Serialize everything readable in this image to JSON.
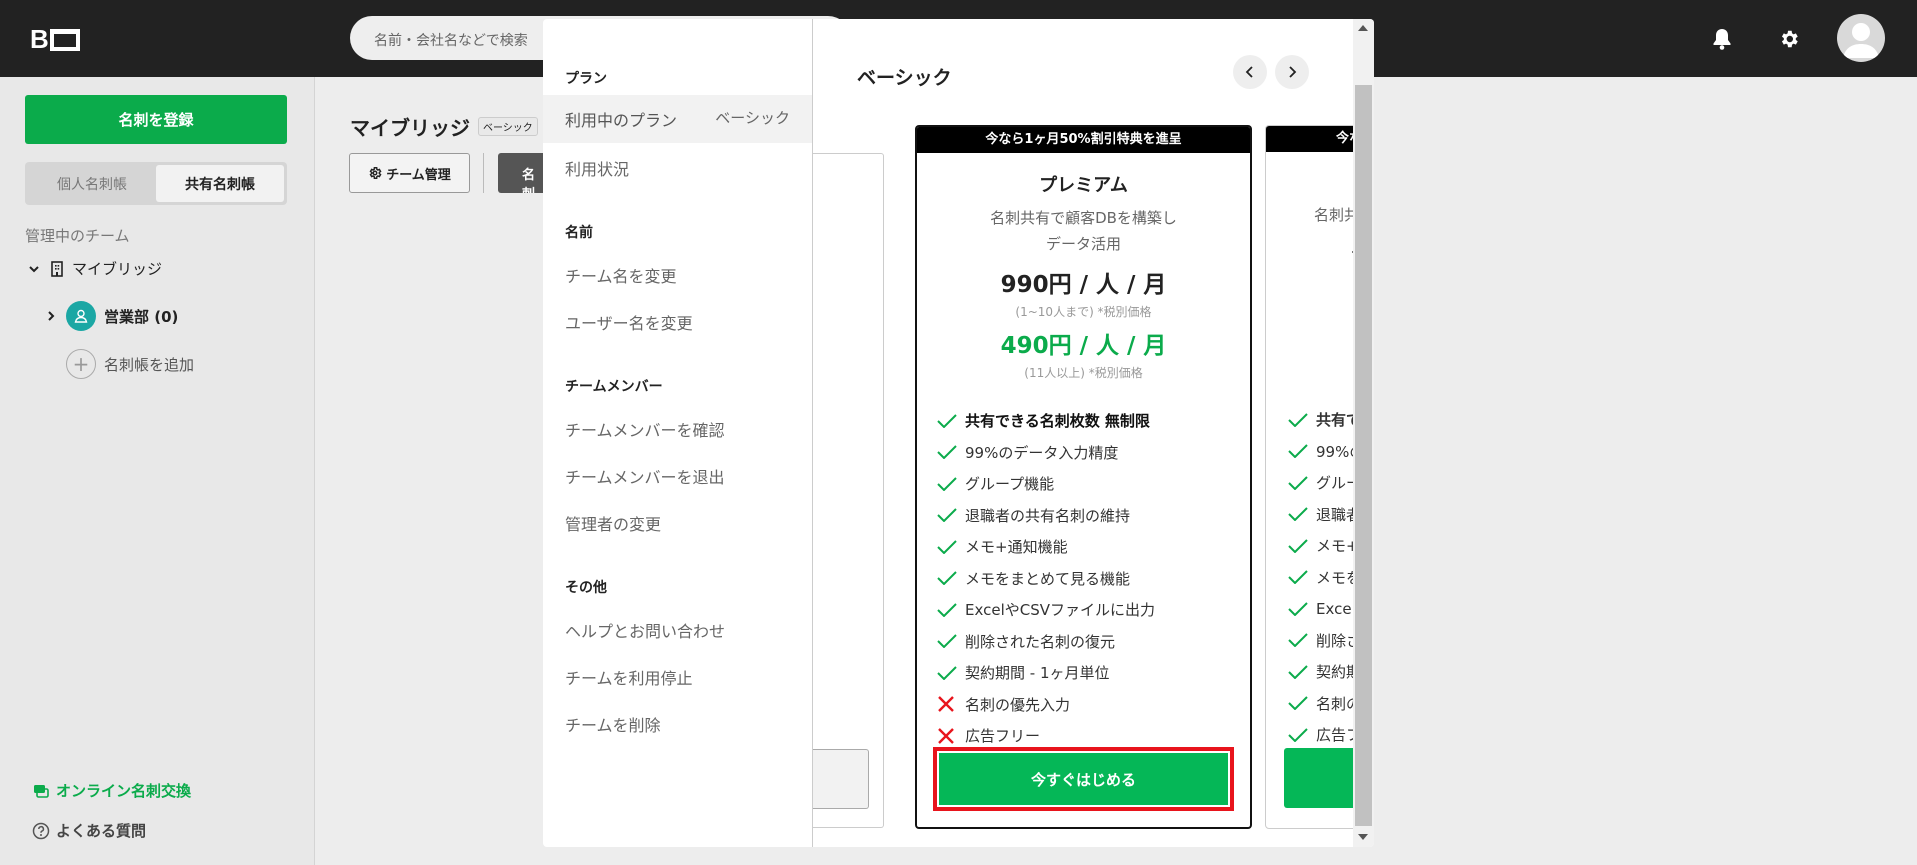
{
  "topbar": {
    "logo_text": "B",
    "search_placeholder": "名前・会社名などで検索",
    "icons": [
      "bell-icon",
      "gear-icon",
      "avatar"
    ]
  },
  "sidebar": {
    "register_button": "名刺を登録",
    "segments": [
      "個人名刺帳",
      "共有名刺帳"
    ],
    "active_segment": "共有名刺帳",
    "section_label": "管理中のチーム",
    "team_name": "マイブリッジ",
    "group_name": "営業部 (0)",
    "add_book": "名刺帳を追加",
    "online_exchange": "オンライン名刺交換",
    "faq": "よくある質問"
  },
  "main": {
    "title": "マイブリッジ",
    "title_tag": "ベーシック",
    "team_manage_button": "チーム管理",
    "dark_button_text": "名刺"
  },
  "modal": {
    "menu": {
      "plan_heading": "プラン",
      "current_plan_label": "利用中のプラン",
      "current_plan_value": "ベーシック",
      "usage": "利用状況",
      "name_heading": "名前",
      "change_team_name": "チーム名を変更",
      "change_user_name": "ユーザー名を変更",
      "members_heading": "チームメンバー",
      "check_members": "チームメンバーを確認",
      "leave_members": "チームメンバーを退出",
      "change_admin": "管理者の変更",
      "other_heading": "その他",
      "help": "ヘルプとお問い合わせ",
      "stop_team": "チームを利用停止",
      "delete_team": "チームを削除"
    },
    "content": {
      "plan_title": "ベーシック",
      "card": {
        "banner": "今なら1ヶ月50%割引特典を進呈",
        "name": "プレミアム",
        "description": "名刺共有で顧客DBを構築し\nデータ活用",
        "price_main": "990円 / 人 / 月",
        "price_main_note": "(1~10人まで) *税別価格",
        "price_discount": "490円 / 人 / 月",
        "price_discount_note": "(11人以上) *税別価格",
        "features": [
          {
            "text": "共有できる名刺枚数 無制限",
            "included": true,
            "bold": true
          },
          {
            "text": "99%のデータ入力精度",
            "included": true,
            "bold": false
          },
          {
            "text": "グループ機能",
            "included": true,
            "bold": false
          },
          {
            "text": "退職者の共有名刺の維持",
            "included": true,
            "bold": false
          },
          {
            "text": "メモ+通知機能",
            "included": true,
            "bold": false
          },
          {
            "text": "メモをまとめて見る機能",
            "included": true,
            "bold": false
          },
          {
            "text": "ExcelやCSVファイルに出力",
            "included": true,
            "bold": false
          },
          {
            "text": "削除された名刺の復元",
            "included": true,
            "bold": false
          },
          {
            "text": "契約期間 - 1ヶ月単位",
            "included": true,
            "bold": false
          },
          {
            "text": "名刺の優先入力",
            "included": false,
            "bold": false
          },
          {
            "text": "広告フリー",
            "included": false,
            "bold": false
          }
        ],
        "cta": "今すぐはじめる"
      },
      "card2": {
        "banner": "今な",
        "desc_fragment": "名刺共",
        "features": [
          "共有で",
          "99%の",
          "グルー",
          "退職者",
          "メモ+",
          "メモを",
          "Excel",
          "削除さ",
          "契約期",
          "名刺の",
          "広告フ"
        ]
      }
    }
  },
  "colors": {
    "brand_green": "#0bab4b",
    "price_green": "#05b757",
    "highlight_red": "#e8141c",
    "topbar": "#222222"
  }
}
